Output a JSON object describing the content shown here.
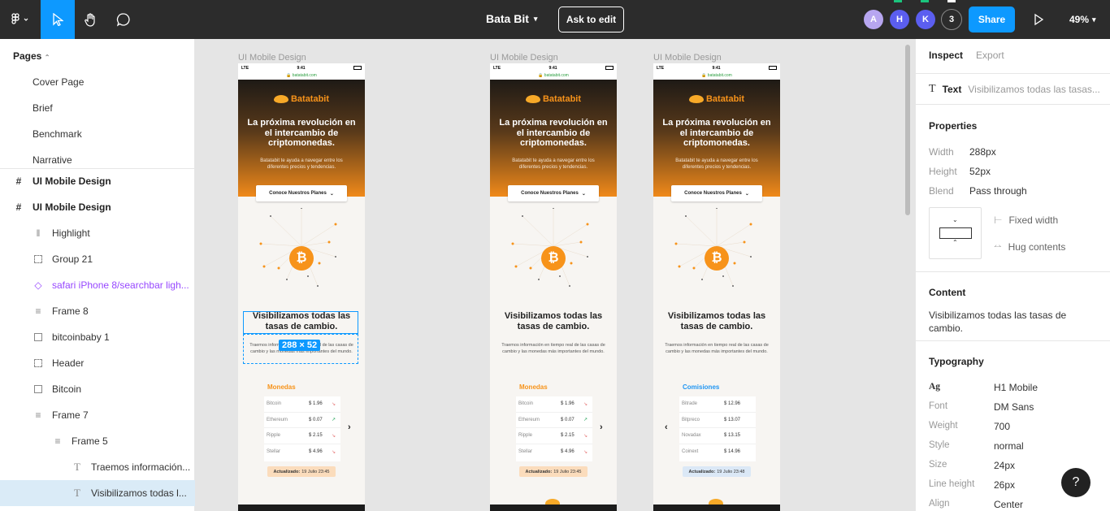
{
  "topbar": {
    "title": "Bata Bit",
    "ask_to_edit": "Ask to edit",
    "avatars": [
      "A",
      "H",
      "K"
    ],
    "avatar_count": "3",
    "share": "Share",
    "zoom": "49%",
    "avatar_colors": [
      "#b7a6f0",
      "#5b5ef0",
      "#5b5ef0"
    ]
  },
  "left": {
    "pages_heading": "Pages",
    "pages": [
      "Cover Page",
      "Brief",
      "Benchmark",
      "Narrative"
    ],
    "layers": [
      {
        "label": "UI Mobile Design",
        "icon": "frame-icon"
      },
      {
        "label": "UI Mobile Design",
        "icon": "frame-icon"
      },
      {
        "label": "Highlight",
        "icon": "columns-icon"
      },
      {
        "label": "Group 21",
        "icon": "group-icon"
      },
      {
        "label": "safari iPhone 8/searchbar ligh...",
        "icon": "component-icon"
      },
      {
        "label": "Frame 8",
        "icon": "rows-icon"
      },
      {
        "label": "bitcoinbaby 1",
        "icon": "image-icon"
      },
      {
        "label": "Header",
        "icon": "group-icon"
      },
      {
        "label": "Bitcoin",
        "icon": "image-icon"
      },
      {
        "label": "Frame 7",
        "icon": "rows-icon"
      },
      {
        "label": "Frame 5",
        "icon": "rows-icon"
      },
      {
        "label": "Traemos información...",
        "icon": "text-icon"
      },
      {
        "label": "Visibilizamos todas l...",
        "icon": "text-icon"
      }
    ]
  },
  "canvas": {
    "frame_label": "UI Mobile Design",
    "selection_dims": "288 × 52",
    "phone": {
      "time": "9:41",
      "carrier": "LTE",
      "url": "🔒 batatabit.com",
      "brand": "Batatabit",
      "headline": "La próxima revolución en el intercambio de criptomonedas.",
      "subtext": "Batatabit te ayuda a navegar entre los diferentes precios y tendencias.",
      "cta": "Conoce Nuestros Planes",
      "section_title": "Visibilizamos todas las tasas de cambio.",
      "section_desc": "Traemos información en tiempo real de las casas de cambio y las monedas más importantes del mundo.",
      "updated_label": "Actualizado:",
      "updated_a": "19 Julio 23:45",
      "updated_b": "19 Julio 23:48"
    },
    "coins_title": "Monedas",
    "coins": [
      {
        "name": "Bitcoin",
        "value": "$ 1.96",
        "trend": "down"
      },
      {
        "name": "Ethereum",
        "value": "$ 0.07",
        "trend": "up"
      },
      {
        "name": "Ripple",
        "value": "$ 2.15",
        "trend": "down"
      },
      {
        "name": "Stellar",
        "value": "$ 4.96",
        "trend": "down"
      }
    ],
    "fees_title": "Comisiones",
    "fees": [
      {
        "name": "Bitrade",
        "value": "$ 12.96"
      },
      {
        "name": "Bitpreco",
        "value": "$ 13.07"
      },
      {
        "name": "Novadax",
        "value": "$ 13.15"
      },
      {
        "name": "Coinext",
        "value": "$ 14.96"
      }
    ]
  },
  "right": {
    "tab_inspect": "Inspect",
    "tab_export": "Export",
    "layer_type": "Text",
    "layer_name": "Visibilizamos todas las tasas...",
    "properties_heading": "Properties",
    "width_label": "Width",
    "width_value": "288px",
    "height_label": "Height",
    "height_value": "52px",
    "blend_label": "Blend",
    "blend_value": "Pass through",
    "fixed_width": "Fixed width",
    "hug_contents": "Hug contents",
    "content_heading": "Content",
    "content_value": "Visibilizamos todas las tasas de cambio.",
    "typography_heading": "Typography",
    "style_name": "H1 Mobile",
    "typo": [
      {
        "label": "Font",
        "value": "DM Sans"
      },
      {
        "label": "Weight",
        "value": "700"
      },
      {
        "label": "Style",
        "value": "normal"
      },
      {
        "label": "Size",
        "value": "24px"
      },
      {
        "label": "Line height",
        "value": "26px"
      },
      {
        "label": "Align",
        "value": "Center"
      }
    ],
    "help": "?"
  },
  "colors": {
    "accent": "#0d99ff",
    "bitcoin": "#f7931a",
    "topbar": "#2c2c2c"
  }
}
